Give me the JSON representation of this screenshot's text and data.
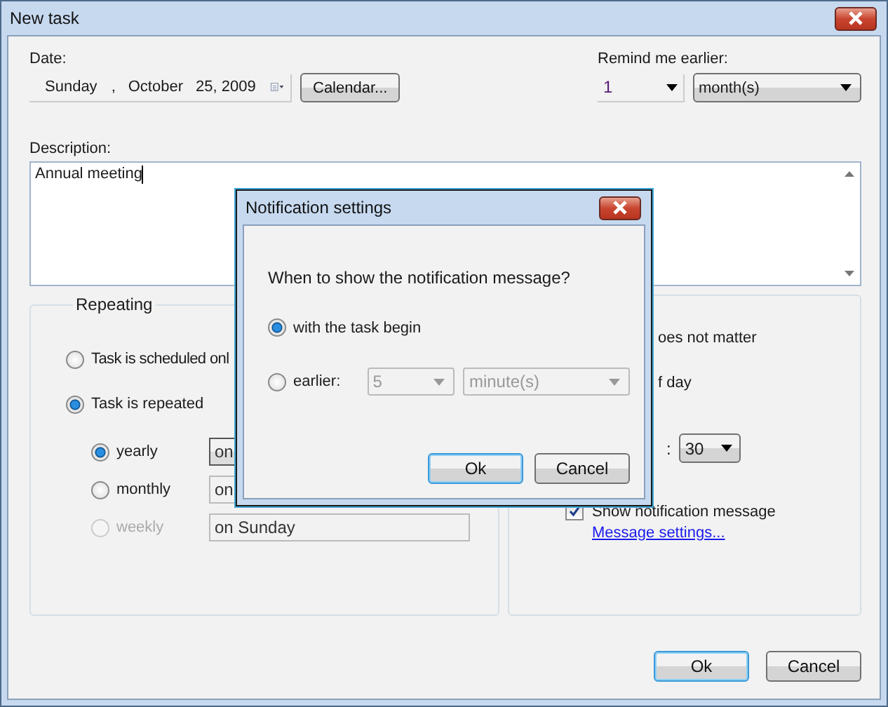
{
  "window": {
    "title": "New task"
  },
  "date": {
    "label": "Date:",
    "weekday": "Sunday",
    "separator": ",",
    "month": "October",
    "day_year": "25, 2009"
  },
  "calendar_button": "Calendar...",
  "remind": {
    "label": "Remind me earlier:",
    "amount": "1",
    "unit": "month(s)"
  },
  "description": {
    "label": "Description:",
    "value": "Annual meeting"
  },
  "repeating": {
    "title": "Repeating",
    "modes": [
      {
        "label": "Task is scheduled onl",
        "selected": false
      },
      {
        "label": "Task is repeated",
        "selected": true
      }
    ],
    "frequencies": [
      {
        "label": "yearly",
        "selected": true,
        "disabled": false,
        "value": "on"
      },
      {
        "label": "monthly",
        "selected": false,
        "disabled": false,
        "value": "on"
      },
      {
        "label": "weekly",
        "selected": false,
        "disabled": true,
        "value": "on Sunday"
      }
    ]
  },
  "time": {
    "options": [
      {
        "label": "oes not matter"
      },
      {
        "label": "f day"
      }
    ],
    "separator": ":",
    "minutes": "30",
    "notification": {
      "label": "Show notification message",
      "checked": true
    },
    "link": "Message settings..."
  },
  "buttons": [
    {
      "label": "Ok",
      "default": true
    },
    {
      "label": "Cancel",
      "default": false
    }
  ],
  "dialog": {
    "title": "Notification settings",
    "question": "When to show the notification message?",
    "options": [
      {
        "kind": "plain",
        "label": "with the task begin",
        "selected": true
      },
      {
        "kind": "amount",
        "label": "earlier:",
        "selected": false,
        "amount": "5",
        "unit": "minute(s)"
      }
    ],
    "buttons": [
      {
        "label": "Ok",
        "default": true
      },
      {
        "label": "Cancel",
        "default": false
      }
    ]
  }
}
